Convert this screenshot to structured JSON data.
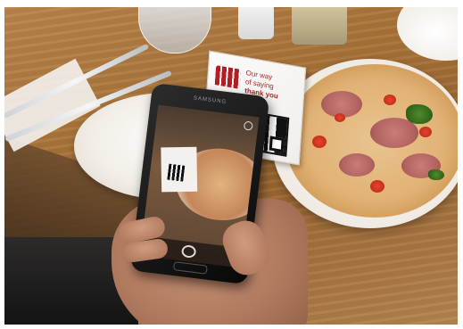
{
  "stand": {
    "line1": "Our way",
    "line2": "of saying",
    "line3": "thank you"
  },
  "phone": {
    "brand": "SAMSUNG"
  },
  "colors": {
    "table": "#a87238",
    "brand_red": "#b31d24",
    "phone_body": "#111111"
  }
}
